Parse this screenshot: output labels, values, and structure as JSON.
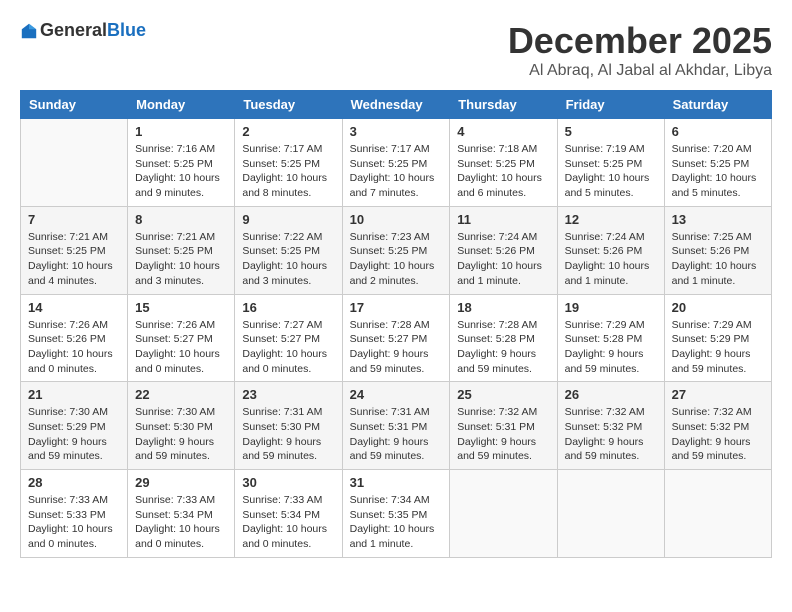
{
  "header": {
    "logo_general": "General",
    "logo_blue": "Blue",
    "month_title": "December 2025",
    "location": "Al Abraq, Al Jabal al Akhdar, Libya"
  },
  "days_of_week": [
    "Sunday",
    "Monday",
    "Tuesday",
    "Wednesday",
    "Thursday",
    "Friday",
    "Saturday"
  ],
  "weeks": [
    [
      {
        "day": "",
        "info": ""
      },
      {
        "day": "1",
        "info": "Sunrise: 7:16 AM\nSunset: 5:25 PM\nDaylight: 10 hours\nand 9 minutes."
      },
      {
        "day": "2",
        "info": "Sunrise: 7:17 AM\nSunset: 5:25 PM\nDaylight: 10 hours\nand 8 minutes."
      },
      {
        "day": "3",
        "info": "Sunrise: 7:17 AM\nSunset: 5:25 PM\nDaylight: 10 hours\nand 7 minutes."
      },
      {
        "day": "4",
        "info": "Sunrise: 7:18 AM\nSunset: 5:25 PM\nDaylight: 10 hours\nand 6 minutes."
      },
      {
        "day": "5",
        "info": "Sunrise: 7:19 AM\nSunset: 5:25 PM\nDaylight: 10 hours\nand 5 minutes."
      },
      {
        "day": "6",
        "info": "Sunrise: 7:20 AM\nSunset: 5:25 PM\nDaylight: 10 hours\nand 5 minutes."
      }
    ],
    [
      {
        "day": "7",
        "info": "Sunrise: 7:21 AM\nSunset: 5:25 PM\nDaylight: 10 hours\nand 4 minutes."
      },
      {
        "day": "8",
        "info": "Sunrise: 7:21 AM\nSunset: 5:25 PM\nDaylight: 10 hours\nand 3 minutes."
      },
      {
        "day": "9",
        "info": "Sunrise: 7:22 AM\nSunset: 5:25 PM\nDaylight: 10 hours\nand 3 minutes."
      },
      {
        "day": "10",
        "info": "Sunrise: 7:23 AM\nSunset: 5:25 PM\nDaylight: 10 hours\nand 2 minutes."
      },
      {
        "day": "11",
        "info": "Sunrise: 7:24 AM\nSunset: 5:26 PM\nDaylight: 10 hours\nand 1 minute."
      },
      {
        "day": "12",
        "info": "Sunrise: 7:24 AM\nSunset: 5:26 PM\nDaylight: 10 hours\nand 1 minute."
      },
      {
        "day": "13",
        "info": "Sunrise: 7:25 AM\nSunset: 5:26 PM\nDaylight: 10 hours\nand 1 minute."
      }
    ],
    [
      {
        "day": "14",
        "info": "Sunrise: 7:26 AM\nSunset: 5:26 PM\nDaylight: 10 hours\nand 0 minutes."
      },
      {
        "day": "15",
        "info": "Sunrise: 7:26 AM\nSunset: 5:27 PM\nDaylight: 10 hours\nand 0 minutes."
      },
      {
        "day": "16",
        "info": "Sunrise: 7:27 AM\nSunset: 5:27 PM\nDaylight: 10 hours\nand 0 minutes."
      },
      {
        "day": "17",
        "info": "Sunrise: 7:28 AM\nSunset: 5:27 PM\nDaylight: 9 hours\nand 59 minutes."
      },
      {
        "day": "18",
        "info": "Sunrise: 7:28 AM\nSunset: 5:28 PM\nDaylight: 9 hours\nand 59 minutes."
      },
      {
        "day": "19",
        "info": "Sunrise: 7:29 AM\nSunset: 5:28 PM\nDaylight: 9 hours\nand 59 minutes."
      },
      {
        "day": "20",
        "info": "Sunrise: 7:29 AM\nSunset: 5:29 PM\nDaylight: 9 hours\nand 59 minutes."
      }
    ],
    [
      {
        "day": "21",
        "info": "Sunrise: 7:30 AM\nSunset: 5:29 PM\nDaylight: 9 hours\nand 59 minutes."
      },
      {
        "day": "22",
        "info": "Sunrise: 7:30 AM\nSunset: 5:30 PM\nDaylight: 9 hours\nand 59 minutes."
      },
      {
        "day": "23",
        "info": "Sunrise: 7:31 AM\nSunset: 5:30 PM\nDaylight: 9 hours\nand 59 minutes."
      },
      {
        "day": "24",
        "info": "Sunrise: 7:31 AM\nSunset: 5:31 PM\nDaylight: 9 hours\nand 59 minutes."
      },
      {
        "day": "25",
        "info": "Sunrise: 7:32 AM\nSunset: 5:31 PM\nDaylight: 9 hours\nand 59 minutes."
      },
      {
        "day": "26",
        "info": "Sunrise: 7:32 AM\nSunset: 5:32 PM\nDaylight: 9 hours\nand 59 minutes."
      },
      {
        "day": "27",
        "info": "Sunrise: 7:32 AM\nSunset: 5:32 PM\nDaylight: 9 hours\nand 59 minutes."
      }
    ],
    [
      {
        "day": "28",
        "info": "Sunrise: 7:33 AM\nSunset: 5:33 PM\nDaylight: 10 hours\nand 0 minutes."
      },
      {
        "day": "29",
        "info": "Sunrise: 7:33 AM\nSunset: 5:34 PM\nDaylight: 10 hours\nand 0 minutes."
      },
      {
        "day": "30",
        "info": "Sunrise: 7:33 AM\nSunset: 5:34 PM\nDaylight: 10 hours\nand 0 minutes."
      },
      {
        "day": "31",
        "info": "Sunrise: 7:34 AM\nSunset: 5:35 PM\nDaylight: 10 hours\nand 1 minute."
      },
      {
        "day": "",
        "info": ""
      },
      {
        "day": "",
        "info": ""
      },
      {
        "day": "",
        "info": ""
      }
    ]
  ]
}
